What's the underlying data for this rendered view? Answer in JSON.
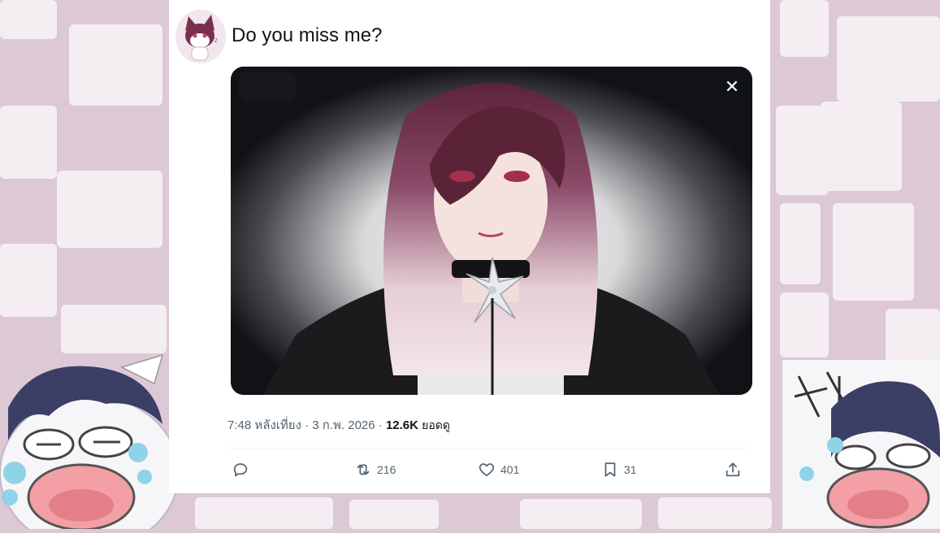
{
  "tweet": {
    "text": "Do you miss me?",
    "time": "7:48 หลังเที่ยง",
    "separator": "·",
    "date": "3 ก.พ. 2026",
    "views_count": "12.6K",
    "views_label": "ยอดดู",
    "media_close": "✕"
  },
  "actions": {
    "reply_count": "",
    "retweet_count": "216",
    "like_count": "401",
    "bookmark_count": "31"
  },
  "colors": {
    "background_pink": "#ddc8d6",
    "card": "#ffffff",
    "text_primary": "#0f1419",
    "text_secondary": "#536471"
  }
}
